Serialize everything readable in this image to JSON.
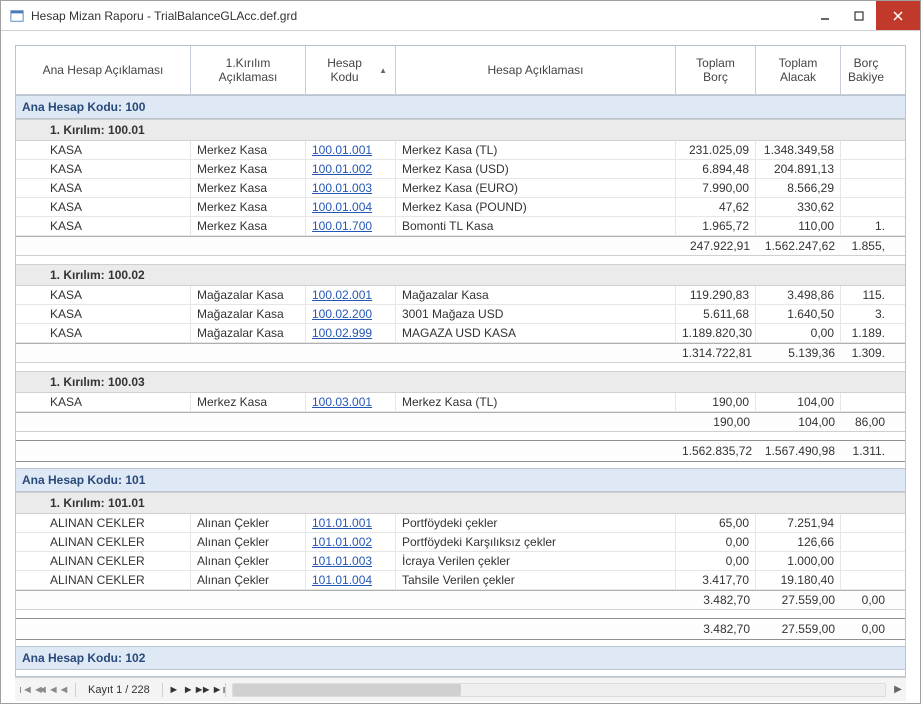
{
  "window": {
    "title": "Hesap Mizan Raporu - TrialBalanceGLAcc.def.grd"
  },
  "columns": {
    "ana": "Ana Hesap Açıklaması",
    "k1": "1.Kırılım Açıklaması",
    "kod": "Hesap Kodu",
    "acik": "Hesap Açıklaması",
    "borc": "Toplam Borç",
    "alacak": "Toplam Alacak",
    "bakiye": "Borç Bakiye"
  },
  "labels": {
    "ana_prefix": "Ana Hesap Kodu: ",
    "sub_prefix": "1. Kırılım: "
  },
  "groups": [
    {
      "code": "100",
      "subs": [
        {
          "code": "100.01",
          "rows": [
            {
              "ana": "KASA",
              "k1": "Merkez Kasa",
              "kod": "100.01.001",
              "acik": "Merkez Kasa (TL)",
              "borc": "231.025,09",
              "alacak": "1.348.349,58",
              "bakiye": ""
            },
            {
              "ana": "KASA",
              "k1": "Merkez Kasa",
              "kod": "100.01.002",
              "acik": "Merkez Kasa (USD)",
              "borc": "6.894,48",
              "alacak": "204.891,13",
              "bakiye": ""
            },
            {
              "ana": "KASA",
              "k1": "Merkez Kasa",
              "kod": "100.01.003",
              "acik": "Merkez Kasa (EURO)",
              "borc": "7.990,00",
              "alacak": "8.566,29",
              "bakiye": ""
            },
            {
              "ana": "KASA",
              "k1": "Merkez Kasa",
              "kod": "100.01.004",
              "acik": "Merkez Kasa (POUND)",
              "borc": "47,62",
              "alacak": "330,62",
              "bakiye": ""
            },
            {
              "ana": "KASA",
              "k1": "Merkez Kasa",
              "kod": "100.01.700",
              "acik": "Bomonti TL Kasa",
              "borc": "1.965,72",
              "alacak": "110,00",
              "bakiye": "1."
            }
          ],
          "subtotal": {
            "borc": "247.922,91",
            "alacak": "1.562.247,62",
            "bakiye": "1.855,"
          }
        },
        {
          "code": "100.02",
          "rows": [
            {
              "ana": "KASA",
              "k1": "Mağazalar Kasa",
              "kod": "100.02.001",
              "acik": "Mağazalar Kasa",
              "borc": "119.290,83",
              "alacak": "3.498,86",
              "bakiye": "115."
            },
            {
              "ana": "KASA",
              "k1": "Mağazalar Kasa",
              "kod": "100.02.200",
              "acik": "3001 Mağaza USD",
              "borc": "5.611,68",
              "alacak": "1.640,50",
              "bakiye": "3."
            },
            {
              "ana": "KASA",
              "k1": "Mağazalar Kasa",
              "kod": "100.02.999",
              "acik": "MAGAZA USD KASA",
              "borc": "1.189.820,30",
              "alacak": "0,00",
              "bakiye": "1.189."
            }
          ],
          "subtotal": {
            "borc": "1.314.722,81",
            "alacak": "5.139,36",
            "bakiye": "1.309."
          }
        },
        {
          "code": "100.03",
          "rows": [
            {
              "ana": "KASA",
              "k1": "Merkez Kasa",
              "kod": "100.03.001",
              "acik": "Merkez Kasa (TL)",
              "borc": "190,00",
              "alacak": "104,00",
              "bakiye": ""
            }
          ],
          "subtotal": {
            "borc": "190,00",
            "alacak": "104,00",
            "bakiye": "86,00"
          }
        }
      ],
      "total": {
        "borc": "1.562.835,72",
        "alacak": "1.567.490,98",
        "bakiye": "1.311."
      }
    },
    {
      "code": "101",
      "subs": [
        {
          "code": "101.01",
          "rows": [
            {
              "ana": "ALINAN CEKLER",
              "k1": "Alınan Çekler",
              "kod": "101.01.001",
              "acik": "Portföydeki çekler",
              "borc": "65,00",
              "alacak": "7.251,94",
              "bakiye": ""
            },
            {
              "ana": "ALINAN CEKLER",
              "k1": "Alınan Çekler",
              "kod": "101.01.002",
              "acik": "Portföydeki Karşılıksız çekler",
              "borc": "0,00",
              "alacak": "126,66",
              "bakiye": ""
            },
            {
              "ana": "ALINAN CEKLER",
              "k1": "Alınan Çekler",
              "kod": "101.01.003",
              "acik": "İcraya Verilen çekler",
              "borc": "0,00",
              "alacak": "1.000,00",
              "bakiye": ""
            },
            {
              "ana": "ALINAN CEKLER",
              "k1": "Alınan Çekler",
              "kod": "101.01.004",
              "acik": "Tahsile Verilen çekler",
              "borc": "3.417,70",
              "alacak": "19.180,40",
              "bakiye": ""
            }
          ],
          "subtotal": {
            "borc": "3.482,70",
            "alacak": "27.559,00",
            "bakiye": "0,00"
          }
        }
      ],
      "total": {
        "borc": "3.482,70",
        "alacak": "27.559,00",
        "bakiye": "0,00"
      }
    },
    {
      "code": "102",
      "subs": [],
      "total": null
    }
  ],
  "pager": {
    "label": "Kayıt 1 / 228"
  }
}
